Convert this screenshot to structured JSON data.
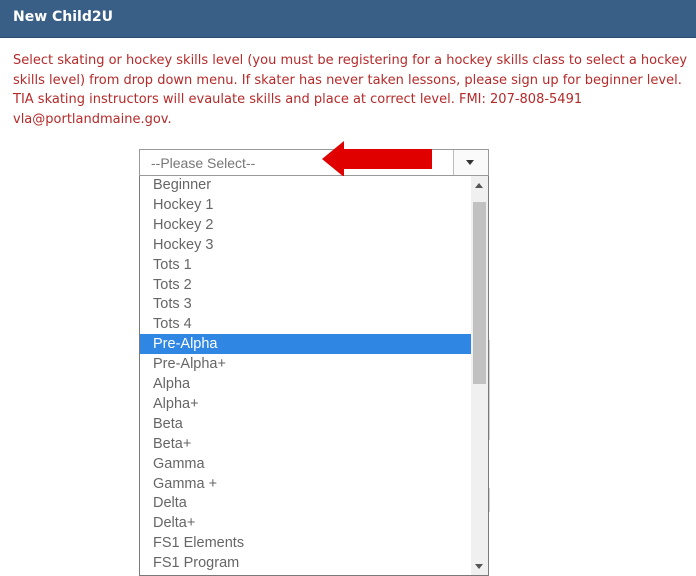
{
  "header": {
    "title": "New Child2U"
  },
  "instructions": {
    "lines": [
      "Select skating or hockey skills level (you must be registering for a hockey skills class to select a hockey",
      "skills level) from drop down menu. If skater has never taken lessons, please sign up for beginner level.",
      "TIA skating instructors will evaulate skills and place at correct level. FMI: 207-808-5491",
      "vla@portlandmaine.gov."
    ]
  },
  "select": {
    "value": "--Please Select--",
    "options": [
      "Beginner",
      "Hockey 1",
      "Hockey 2",
      "Hockey 3",
      "Tots 1",
      "Tots 2",
      "Tots 3",
      "Tots 4",
      "Pre-Alpha",
      "Pre-Alpha+",
      "Alpha",
      "Alpha+",
      "Beta",
      "Beta+",
      "Gamma",
      "Gamma +",
      "Delta",
      "Delta+",
      "FS1 Elements",
      "FS1 Program"
    ],
    "highlighted": "Pre-Alpha"
  },
  "colors": {
    "header_bg": "#3a5f87",
    "instruction_text": "#b52a2a",
    "highlight": "#2f86e3",
    "arrow": "#e00000"
  }
}
